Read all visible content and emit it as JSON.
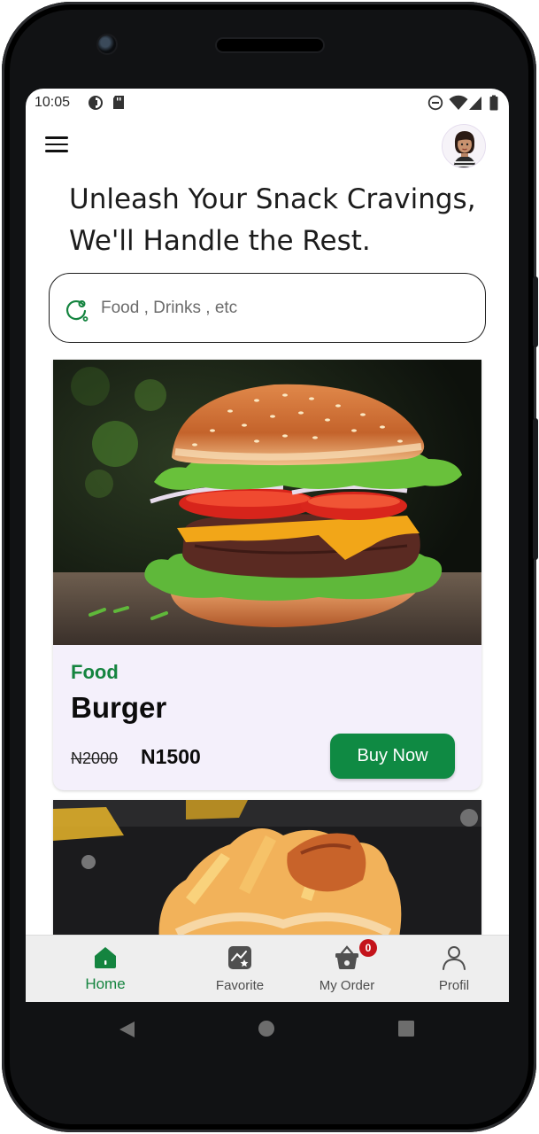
{
  "status_bar": {
    "time": "10:05"
  },
  "header": {
    "headline_line1": "Unleash Your Snack Cravings,",
    "headline_line2": "We'll Handle the Rest."
  },
  "search": {
    "placeholder": "Food , Drinks , etc"
  },
  "products": [
    {
      "category": "Food",
      "name": "Burger",
      "old_price": "N2000",
      "price": "N1500",
      "button_label": "Buy Now"
    }
  ],
  "bottom_nav": {
    "items": [
      {
        "label": "Home",
        "icon": "home-icon",
        "active": true
      },
      {
        "label": "Favorite",
        "icon": "favorite-icon",
        "active": false
      },
      {
        "label": "My Order",
        "icon": "basket-icon",
        "active": false,
        "badge": "0"
      },
      {
        "label": "Profil",
        "icon": "profile-icon",
        "active": false
      }
    ]
  },
  "colors": {
    "accent": "#14843f",
    "button": "#0f8a43",
    "card_bg": "#f4f0fb",
    "badge": "#c4131b"
  }
}
